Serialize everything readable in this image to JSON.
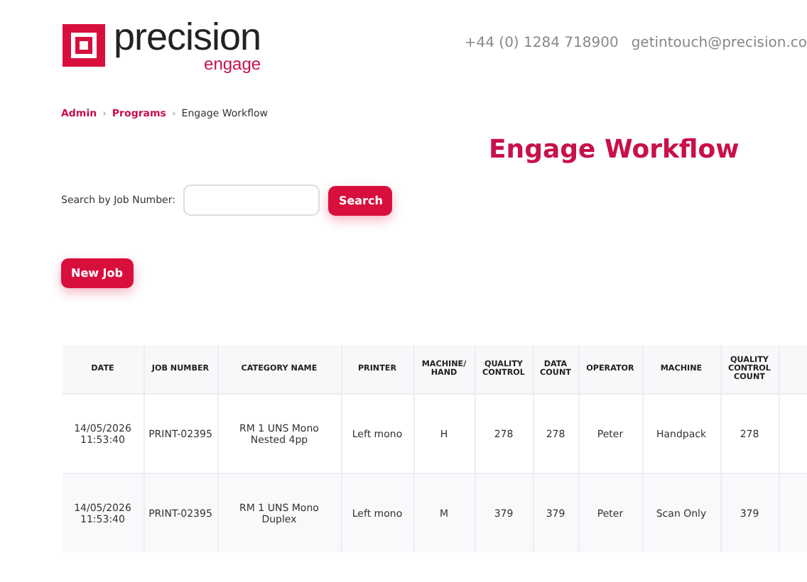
{
  "logo": {
    "word": "precision",
    "sub": "engage"
  },
  "contact": {
    "phone": "+44 (0) 1284 718900",
    "email": "getintouch@precision.co"
  },
  "breadcrumb": [
    "Admin",
    "Programs",
    "Engage Workflow"
  ],
  "breadcrumb_separator": "›",
  "title": "Engage Workflow",
  "search": {
    "label": "Search by Job Number:",
    "button": "Search"
  },
  "new_job_button": "New Job",
  "table": {
    "columns": [
      "DATE",
      "JOB NUMBER",
      "CATEGORY NAME",
      "PRINTER",
      "MACHINE/ HAND",
      "QUALITY CONTROL",
      "DATA COUNT",
      "OPERATOR",
      "MACHINE",
      "QUALITY CONTROL COUNT"
    ],
    "rows": [
      [
        "14/05/2026 11:53:40",
        "PRINT-02395",
        "RM 1 UNS Mono Nested 4pp",
        "Left mono",
        "H",
        "278",
        "278",
        "Peter",
        "Handpack",
        "278"
      ],
      [
        "14/05/2026 11:53:40",
        "PRINT-02395",
        "RM 1 UNS Mono Duplex",
        "Left mono",
        "M",
        "379",
        "379",
        "Peter",
        "Scan Only",
        "379"
      ]
    ]
  }
}
